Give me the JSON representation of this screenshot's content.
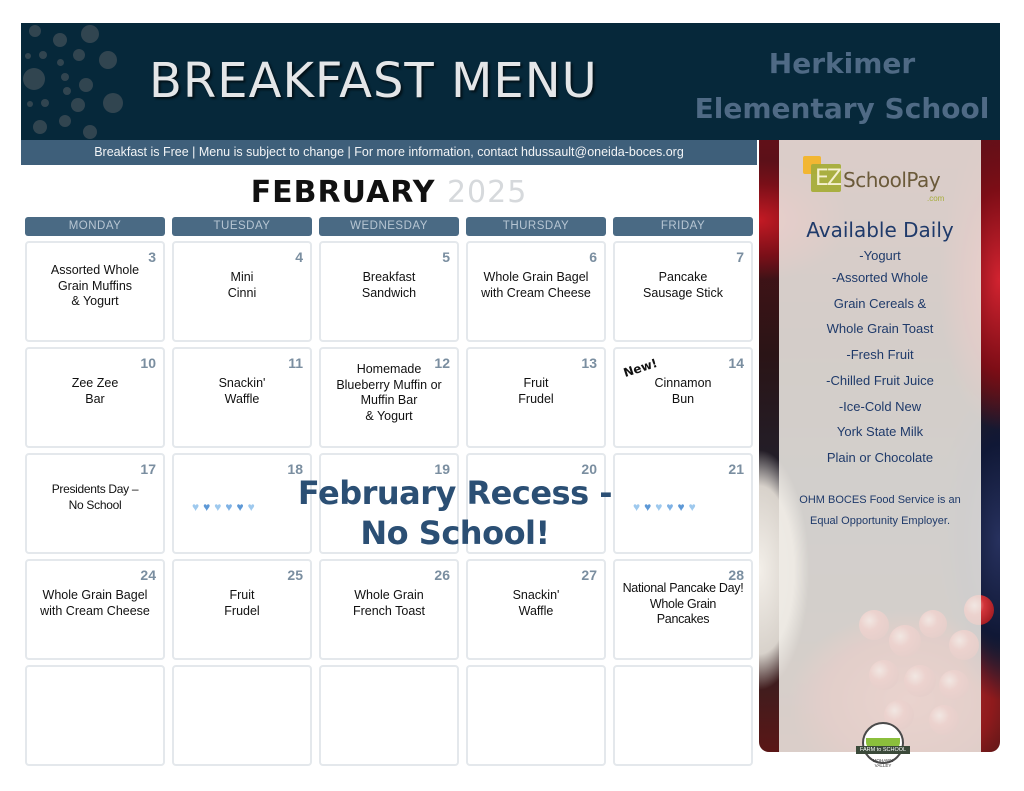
{
  "header": {
    "title": "BREAKFAST MENU",
    "school_line1": "Herkimer",
    "school_line2": "Elementary School",
    "info": "Breakfast is Free  |  Menu is subject to change  |  For more information, contact hdussault@oneida-boces.org"
  },
  "calendar": {
    "month": "FEBRUARY",
    "year": "2025",
    "weekdays": [
      "MONDAY",
      "TUESDAY",
      "WEDNESDAY",
      "THURSDAY",
      "FRIDAY"
    ],
    "weeks": [
      [
        {
          "day": "3",
          "menu": "Assorted Whole\nGrain Muffins\n& Yogurt"
        },
        {
          "day": "4",
          "menu": "Mini\nCinni"
        },
        {
          "day": "5",
          "menu": "Breakfast\nSandwich"
        },
        {
          "day": "6",
          "menu": "Whole Grain Bagel\nwith Cream Cheese"
        },
        {
          "day": "7",
          "menu": "Pancake\nSausage Stick"
        }
      ],
      [
        {
          "day": "10",
          "menu": "Zee Zee\nBar"
        },
        {
          "day": "11",
          "menu": "Snackin'\nWaffle"
        },
        {
          "day": "12",
          "menu": "Homemade\nBlueberry Muffin or\nMuffin Bar\n& Yogurt"
        },
        {
          "day": "13",
          "menu": "Fruit\nFrudel"
        },
        {
          "day": "14",
          "menu": "Cinnamon\nBun",
          "tag": "New!"
        }
      ],
      [
        {
          "day": "17",
          "menu": "Presidents Day –\nNo School"
        },
        {
          "day": "18",
          "menu": ""
        },
        {
          "day": "19",
          "menu": ""
        },
        {
          "day": "20",
          "menu": ""
        },
        {
          "day": "21",
          "menu": ""
        }
      ],
      [
        {
          "day": "24",
          "menu": "Whole Grain Bagel\nwith Cream Cheese"
        },
        {
          "day": "25",
          "menu": "Fruit\nFrudel"
        },
        {
          "day": "26",
          "menu": "Whole Grain\nFrench Toast"
        },
        {
          "day": "27",
          "menu": "Snackin'\nWaffle"
        },
        {
          "day": "28",
          "menu": "National Pancake Day!\nWhole Grain\nPancakes"
        }
      ],
      [
        {
          "day": "",
          "menu": ""
        },
        {
          "day": "",
          "menu": ""
        },
        {
          "day": "",
          "menu": ""
        },
        {
          "day": "",
          "menu": ""
        },
        {
          "day": "",
          "menu": ""
        }
      ]
    ],
    "recess_banner": "February Recess -\nNo School!",
    "heart_icons": "blue-hearts-decoration"
  },
  "sidebar": {
    "logo_ez": "EZ",
    "logo_name": "SchoolPay",
    "logo_com": ".com",
    "available_title": "Available Daily",
    "available_items": [
      "-Yogurt",
      "-Assorted Whole",
      "Grain Cereals &",
      "Whole Grain Toast",
      "-Fresh Fruit",
      "-Chilled Fruit Juice",
      "-Ice-Cold New",
      "York State Milk",
      "Plain or Chocolate"
    ],
    "eoe_line1": "OHM BOCES Food Service is an",
    "eoe_line2": "Equal Opportunity Employer.",
    "badge_top": "FARM to SCHOOL",
    "badge_bottom": "MOHAWK VALLEY"
  },
  "colors": {
    "header_bg": "#06283a",
    "info_bar": "#3e5f7a",
    "weekday_bar": "#4a6a84",
    "school_name": "#4f6a85",
    "recess_text": "#2b4f74",
    "available_text": "#1f3a6a"
  }
}
